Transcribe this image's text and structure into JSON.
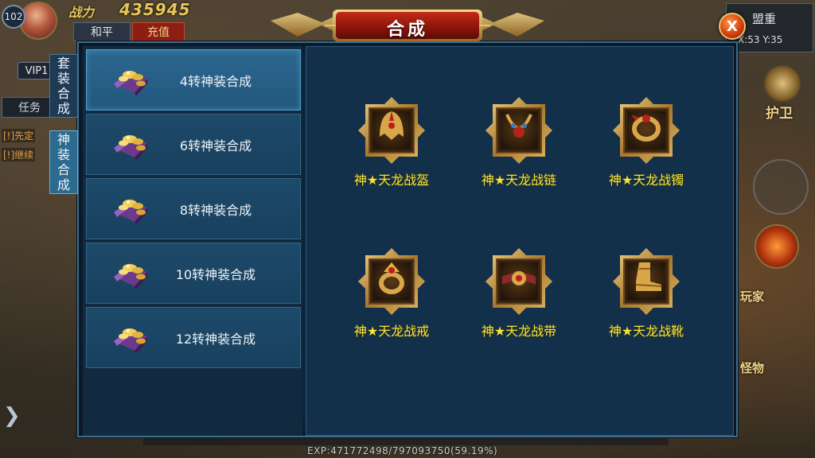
{
  "hud": {
    "level": "102",
    "power_label": "战力",
    "power_value": "435945",
    "peace_label": "和平",
    "recharge_label": "充值",
    "vip_label": "VIP1",
    "task_label": "任务",
    "quest_lines": [
      "[!]先定",
      "[!]继续"
    ],
    "alliance_label": "盟重",
    "coords": "X:53 Y:35",
    "guard_label": "护卫",
    "player_label": "玩家",
    "monster_label": "怪物",
    "exp_text": "EXP:471772498/797093750(59.19%)"
  },
  "dialog": {
    "title": "合成",
    "close_label": "X",
    "tabs": [
      {
        "label": "套装合成",
        "chars": [
          "套",
          "装",
          "合",
          "成"
        ]
      },
      {
        "label": "神装合成",
        "chars": [
          "神",
          "装",
          "合",
          "成"
        ]
      }
    ],
    "active_tab": 1,
    "recipes": [
      {
        "label": "4转神装合成"
      },
      {
        "label": "6转神装合成"
      },
      {
        "label": "8转神装合成"
      },
      {
        "label": "10转神装合成"
      },
      {
        "label": "12转神装合成"
      }
    ],
    "active_recipe": 0,
    "items": [
      {
        "name": "神★天龙战盔",
        "icon": "helmet-icon"
      },
      {
        "name": "神★天龙战链",
        "icon": "necklace-icon"
      },
      {
        "name": "神★天龙战镯",
        "icon": "bracelet-icon"
      },
      {
        "name": "神★天龙战戒",
        "icon": "ring-icon"
      },
      {
        "name": "神★天龙战带",
        "icon": "belt-icon"
      },
      {
        "name": "神★天龙战靴",
        "icon": "boots-icon"
      }
    ]
  },
  "colors": {
    "panel_bg": "#0f2236",
    "item_name": "#f3e63c",
    "banner_red": "#9c1c10",
    "gold_frame": "#c89a48"
  }
}
